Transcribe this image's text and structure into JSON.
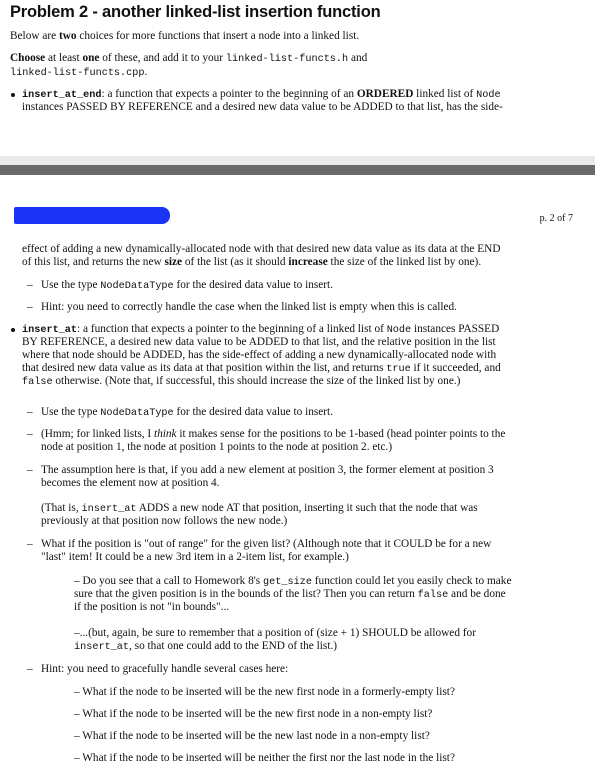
{
  "title": "Problem 2 - another linked-list insertion function",
  "intro": {
    "l1": [
      "Below are ",
      "two",
      " choices for more functions that insert a node into a linked list."
    ],
    "l2": [
      "Choose",
      " at least ",
      "one",
      " of these, and add it to your ",
      "linked-list-functs.h",
      " and"
    ],
    "l3": [
      "linked-list-functs.cpp",
      "."
    ]
  },
  "b1": {
    "l1": [
      "insert_at_end",
      ": a function that expects a pointer to the beginning of an ",
      "ORDERED",
      " linked list of ",
      "Node"
    ],
    "l2": "instances PASSED BY REFERENCE and a desired new data value to be ADDED to that list, has the side-"
  },
  "page_number": "p. 2 of 7",
  "cont": {
    "l1": "effect of adding a new dynamically-allocated node with that desired new data value as its data at the END",
    "l2": [
      "of this list, and returns the new ",
      "size",
      " of the list (as it should ",
      "increase",
      " the size of the linked list by one)."
    ]
  },
  "d1": [
    "Use the type ",
    "NodeDataType",
    " for the desired data value to insert."
  ],
  "d2": "Hint: you need to correctly handle the case when the linked list is empty when this is called.",
  "b2": {
    "l1": [
      "insert_at",
      ": a function that expects a pointer to the beginning of a linked list of ",
      "Node",
      " instances PASSED"
    ],
    "l2": "BY REFERENCE, a desired new data value to be ADDED to that list, and the relative position in the list",
    "l3": "where that node should be ADDED, has the side-effect of adding a new dynamically-allocated node with",
    "l4": [
      "that desired new data value as its data at that position within the list, and returns ",
      "true",
      " if it succeeded, and"
    ],
    "l5": [
      "false",
      " otherwise. (Note that, if successful, this should increase the size of the linked list by one.)"
    ]
  },
  "d3": [
    "Use the type ",
    "NodeDataType",
    " for the desired data value to insert."
  ],
  "d4": {
    "l1": [
      "(Hmm; for linked lists, I ",
      "think",
      " it makes sense for the positions to be 1-based (head pointer points to the"
    ],
    "l2": "node at position 1, the node at position 1 points to the node at position 2. etc.)"
  },
  "d5": {
    "l1": "The assumption here is that, if you add a new element at position 3, the former element at position 3",
    "l2": "becomes the element now at position 4."
  },
  "d5b": {
    "l1": [
      "(That is, ",
      "insert_at",
      " ADDS a new node AT that position, inserting it such that the node that was"
    ],
    "l2": "previously at that position now follows the new node.)"
  },
  "d6": {
    "l1": "What if the position is \"out of range\" for the given list? (Although note that it COULD be for a new",
    "l2": "\"last\" item! It could be a new 3rd item in a 2-item list, for example.)"
  },
  "d6a": {
    "l1": [
      "– Do you see that a call to Homework 8's ",
      "get_size",
      " function could let you easily check to make"
    ],
    "l2": [
      "sure that the given position is in the bounds of the list? Then you can return ",
      "false",
      " and be done"
    ],
    "l3": "if the position is not \"in bounds\"..."
  },
  "d6b": {
    "l1": "–...(but, again, be sure to remember that a position of (size + 1) SHOULD be allowed for",
    "l2": [
      "insert_at",
      ", so that one could add to the END of the list.)"
    ]
  },
  "d7": "Hint: you need to gracefully handle several cases here:",
  "cases": [
    "– What if the node to be inserted will be the new first node in a formerly-empty list?",
    "– What if the node to be inserted will be the new first node in a non-empty list?",
    "– What if the node to be inserted will be the new last node in a non-empty list?",
    "– What if the node to be inserted will be neither the first nor the last node in the list?"
  ]
}
